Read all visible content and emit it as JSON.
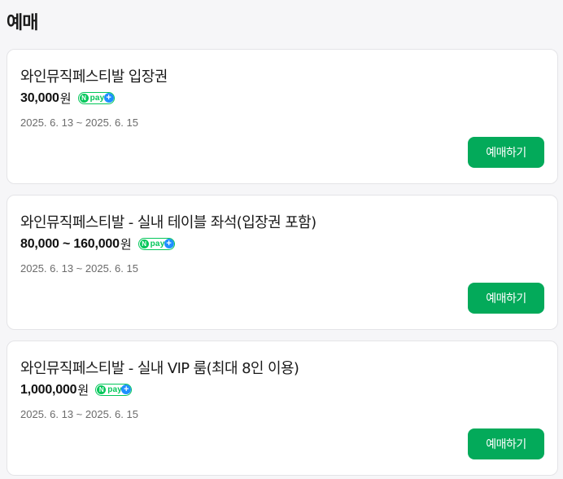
{
  "section": {
    "title": "예매"
  },
  "tickets": [
    {
      "name": "와인뮤직페스티발 입장권",
      "price": "30,000",
      "currency": "원",
      "npay_badge": {
        "letter": "N",
        "text": "pay",
        "plus": "+"
      },
      "dates": "2025. 6. 13 ~ 2025. 6. 15",
      "button_label": "예매하기"
    },
    {
      "name": "와인뮤직페스티발 - 실내 테이블 좌석(입장권 포함)",
      "price": "80,000 ~ 160,000",
      "currency": "원",
      "npay_badge": {
        "letter": "N",
        "text": "pay",
        "plus": "+"
      },
      "dates": "2025. 6. 13 ~ 2025. 6. 15",
      "button_label": "예매하기"
    },
    {
      "name": "와인뮤직페스티발 - 실내 VIP 룸(최대 8인 이용)",
      "price": "1,000,000",
      "currency": "원",
      "npay_badge": {
        "letter": "N",
        "text": "pay",
        "plus": "+"
      },
      "dates": "2025. 6. 13 ~ 2025. 6. 15",
      "button_label": "예매하기"
    }
  ],
  "colors": {
    "accent_green": "#03aa5a",
    "npay_green": "#03c75a",
    "npay_plus_blue": "#1e90ff"
  }
}
